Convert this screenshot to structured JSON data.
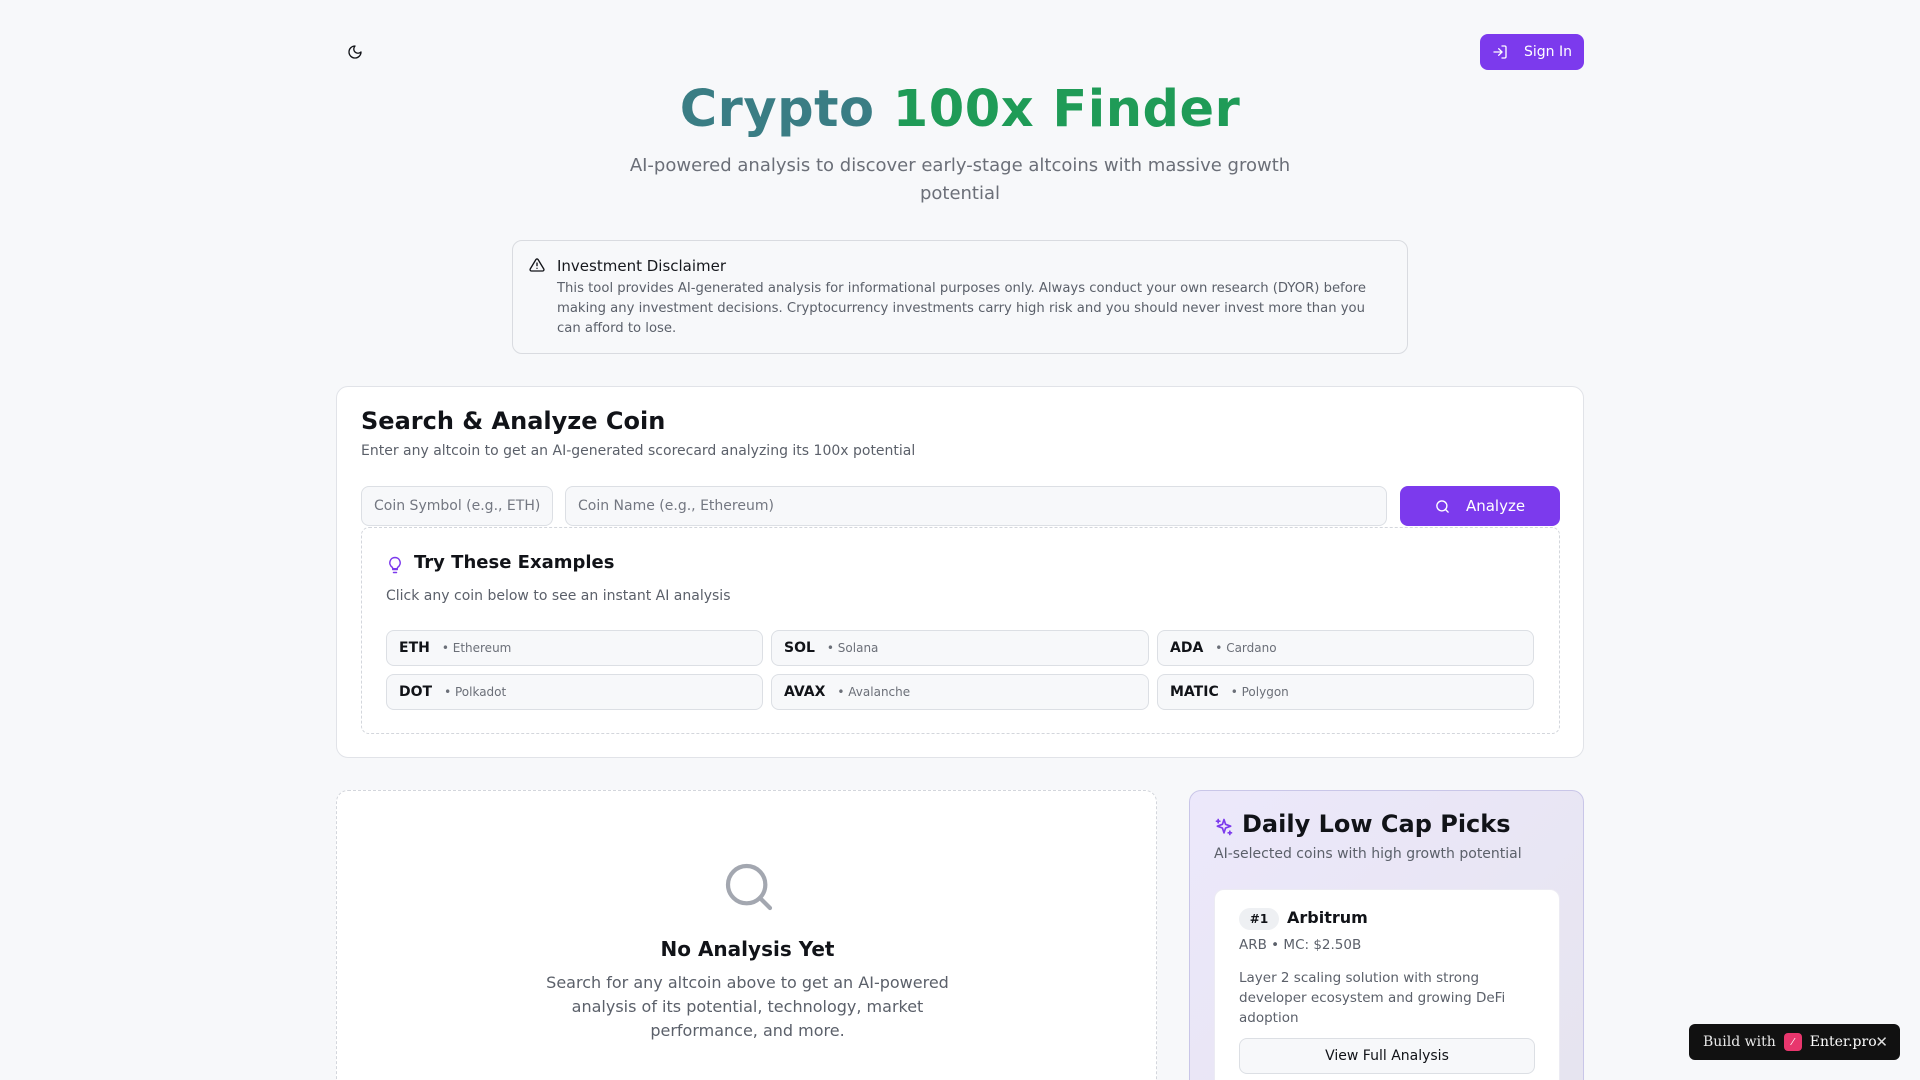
{
  "header": {
    "theme_icon": "moon-icon",
    "signin_label": "Sign In",
    "title_part1": "Crypto",
    "title_part2": "100x Finder",
    "subtitle": "AI-powered analysis to discover early-stage altcoins with massive growth potential"
  },
  "disclaimer": {
    "title": "Investment Disclaimer",
    "text": "This tool provides AI-generated analysis for informational purposes only. Always conduct your own research (DYOR) before making any investment decisions. Cryptocurrency investments carry high risk and you should never invest more than you can afford to lose."
  },
  "search": {
    "title": "Search & Analyze Coin",
    "subtitle": "Enter any altcoin to get an AI-generated scorecard analyzing its 100x potential",
    "symbol_placeholder": "Coin Symbol (e.g., ETH)",
    "symbol_value": "",
    "name_placeholder": "Coin Name (e.g., Ethereum)",
    "name_value": "",
    "analyze_label": "Analyze"
  },
  "examples": {
    "title": "Try These Examples",
    "subtitle": "Click any coin below to see an instant AI analysis",
    "coins": [
      {
        "symbol": "ETH",
        "name": "• Ethereum"
      },
      {
        "symbol": "SOL",
        "name": "• Solana"
      },
      {
        "symbol": "ADA",
        "name": "• Cardano"
      },
      {
        "symbol": "DOT",
        "name": "• Polkadot"
      },
      {
        "symbol": "AVAX",
        "name": "• Avalanche"
      },
      {
        "symbol": "MATIC",
        "name": "• Polygon"
      }
    ]
  },
  "empty_state": {
    "title": "No Analysis Yet",
    "text": "Search for any altcoin above to get an AI-powered analysis of its potential, technology, market performance, and more."
  },
  "picks": {
    "title": "Daily Low Cap Picks",
    "subtitle": "AI-selected coins with high growth potential",
    "items": [
      {
        "rank": "#1",
        "name": "Arbitrum",
        "meta": "ARB  • MC: $2.50B",
        "description": "Layer 2 scaling solution with strong developer ecosystem and growing DeFi adoption",
        "button": "View Full Analysis"
      }
    ]
  },
  "badge": {
    "prefix": "Build with",
    "brand": "Enter.pro",
    "close": "✕"
  },
  "colors": {
    "accent": "#7c3aed",
    "title_teal": "#3a7d84",
    "title_green": "#1f9b57",
    "background": "#f7f8fa"
  }
}
